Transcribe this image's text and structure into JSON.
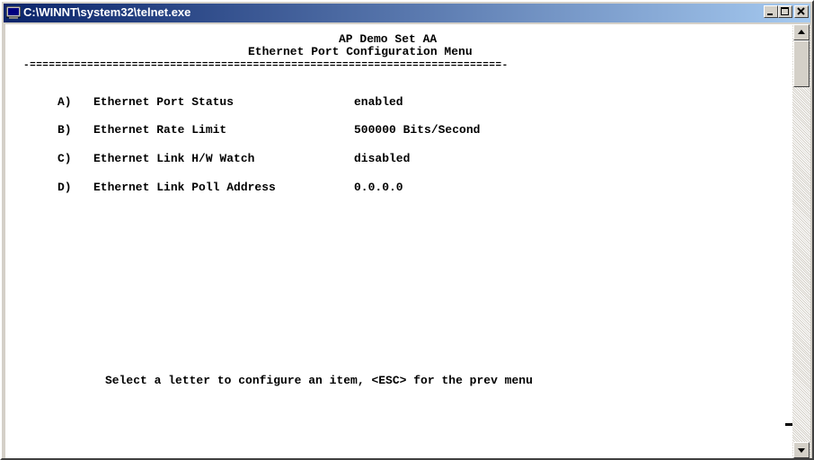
{
  "window": {
    "title": "C:\\WINNT\\system32\\telnet.exe"
  },
  "terminal": {
    "header_line1": "AP Demo Set AA",
    "header_line2": "Ethernet Port Configuration Menu",
    "separator": "-==========================================================================-",
    "items": [
      {
        "key": "A)",
        "label": "Ethernet Port Status",
        "value": "enabled"
      },
      {
        "key": "B)",
        "label": "Ethernet Rate Limit",
        "value": "500000 Bits/Second"
      },
      {
        "key": "C)",
        "label": "Ethernet Link H/W Watch",
        "value": "disabled"
      },
      {
        "key": "D)",
        "label": "Ethernet Link Poll Address",
        "value": "0.0.0.0"
      }
    ],
    "prompt": "Select a letter to configure an item, <ESC> for the prev menu"
  }
}
